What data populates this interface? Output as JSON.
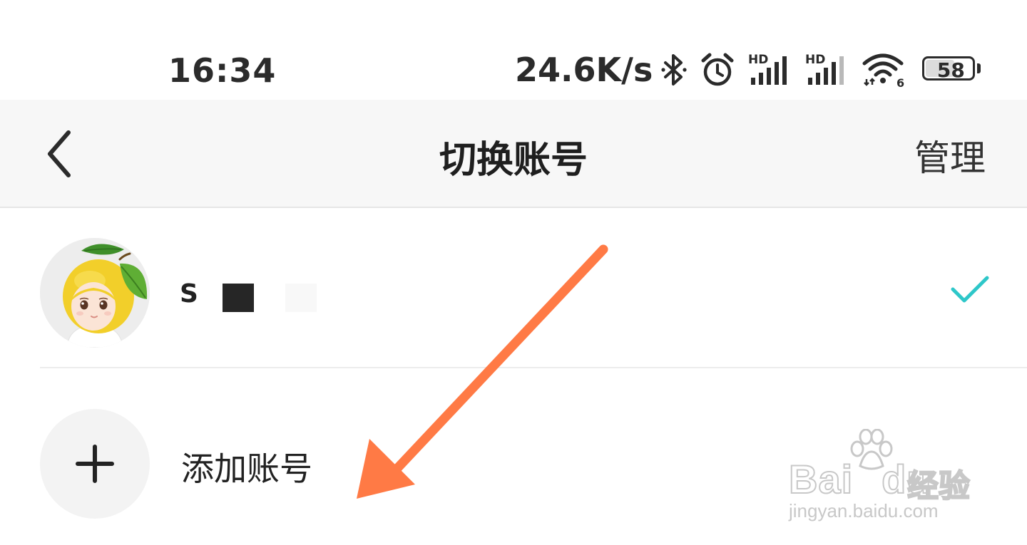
{
  "status_bar": {
    "time": "16:34",
    "net_speed": "24.6K/s",
    "battery_level": "58",
    "battery_fraction": 0.58,
    "icons": [
      "bluetooth-icon",
      "alarm-icon",
      "hd-signal-icon",
      "hd-signal-icon",
      "wifi-icon",
      "battery-icon"
    ],
    "signal_hd_label": "HD",
    "wifi_badge": "6"
  },
  "nav": {
    "title": "切换账号",
    "manage_label": "管理",
    "back_icon": "chevron-left-icon"
  },
  "accounts": [
    {
      "name": "S",
      "selected": true,
      "avatar": "lemon-avatar"
    }
  ],
  "add_account": {
    "label": "添加账号",
    "icon": "plus-icon"
  },
  "watermark": {
    "brand": "Bai",
    "brand_tail": "du",
    "cn": "经验",
    "url": "jingyan.baidu.com"
  },
  "colors": {
    "accent_check": "#2ec7c9",
    "arrow": "#ff7a45",
    "nav_bg": "#f7f7f7"
  }
}
